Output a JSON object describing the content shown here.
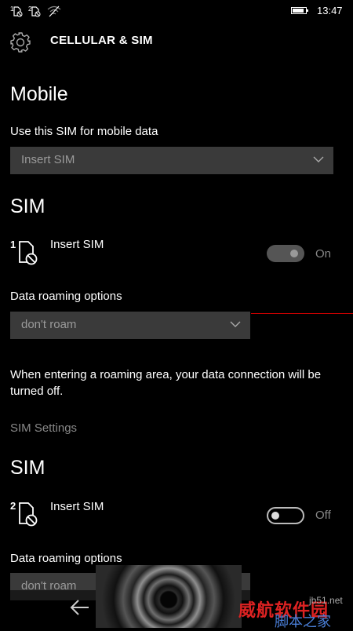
{
  "status_bar": {
    "icons": [
      "sim-1-no-signal-icon",
      "sim-2-no-signal-icon",
      "wifi-no-signal-icon",
      "battery-icon"
    ],
    "battery_level": 0.9,
    "time": "13:47"
  },
  "header": {
    "icon": "gear-icon",
    "title": "CELLULAR & SIM"
  },
  "mobile": {
    "heading": "Mobile",
    "data_sim_label": "Use this SIM for mobile data",
    "data_sim_value": "Insert SIM"
  },
  "sim1": {
    "heading": "SIM",
    "slot_number": "1",
    "name": "Insert SIM",
    "toggle_state": "On",
    "roaming_label": "Data roaming options",
    "roaming_value": "don't roam",
    "roaming_note": "When entering a roaming area, your data connection will be turned off.",
    "settings_link": "SIM Settings"
  },
  "sim2": {
    "heading": "SIM",
    "slot_number": "2",
    "name": "Insert SIM",
    "toggle_state": "Off",
    "roaming_label": "Data roaming options",
    "roaming_value": "don't roam"
  },
  "nav": {
    "back_icon": "back-arrow-icon"
  },
  "watermark": {
    "red_text": "威航软件园",
    "url_text": "jb51.net",
    "blue_text": "脚本之家"
  },
  "colors": {
    "background": "#000000",
    "combo_background": "#3a3a3a",
    "dim_text": "#888888",
    "accent_line": "#cc0000"
  }
}
